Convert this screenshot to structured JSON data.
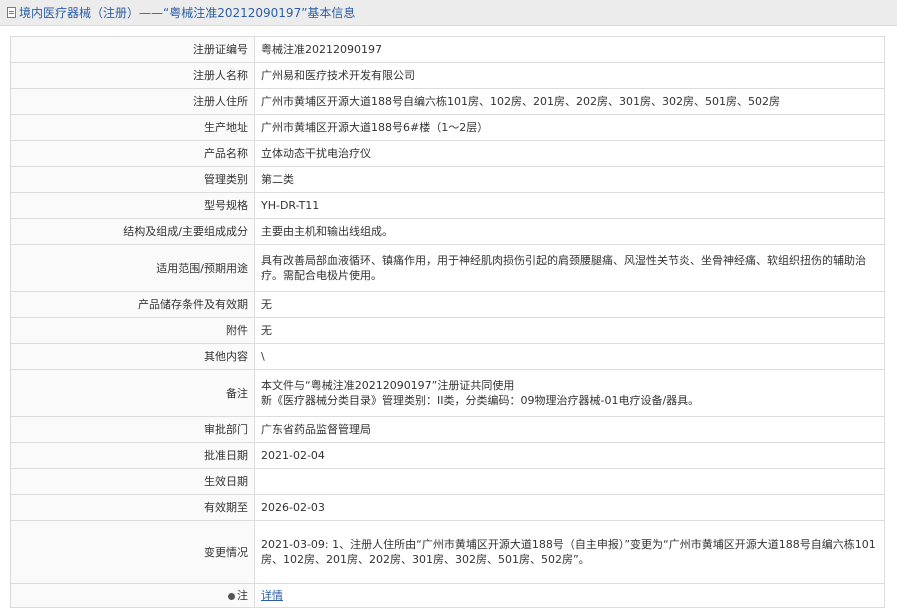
{
  "header": {
    "title": "境内医疗器械（注册）——“粤械注准20212090197”基本信息"
  },
  "rows": {
    "reg_no": {
      "label": "注册证编号",
      "value": "粤械注准20212090197"
    },
    "registrant_name": {
      "label": "注册人名称",
      "value": "广州易和医疗技术开发有限公司"
    },
    "registrant_address": {
      "label": "注册人住所",
      "value": "广州市黄埔区开源大道188号自编六栋101房、102房、201房、202房、301房、302房、501房、502房"
    },
    "production_address": {
      "label": "生产地址",
      "value": "广州市黄埔区开源大道188号6#楼（1～2层）"
    },
    "product_name": {
      "label": "产品名称",
      "value": "立体动态干扰电治疗仪"
    },
    "category": {
      "label": "管理类别",
      "value": "第二类"
    },
    "model": {
      "label": "型号规格",
      "value": "YH-DR-T11"
    },
    "structure": {
      "label": "结构及组成/主要组成成分",
      "value": "主要由主机和输出线组成。"
    },
    "scope": {
      "label": "适用范围/预期用途",
      "value": "具有改善局部血液循环、镇痛作用，用于神经肌肉损伤引起的肩颈腰腿痛、风湿性关节炎、坐骨神经痛、软组织扭伤的辅助治疗。需配合电极片使用。"
    },
    "storage": {
      "label": "产品储存条件及有效期",
      "value": "无"
    },
    "accessories": {
      "label": "附件",
      "value": "无"
    },
    "other": {
      "label": "其他内容",
      "value": "\\"
    },
    "remarks": {
      "label": "备注",
      "line1": "本文件与“粤械注准20212090197”注册证共同使用",
      "line2": "新《医疗器械分类目录》管理类别：II类，分类编码：09物理治疗器械-01电疗设备/器具。"
    },
    "dept": {
      "label": "审批部门",
      "value": "广东省药品监督管理局"
    },
    "approval_date": {
      "label": "批准日期",
      "value": "2021-02-04"
    },
    "effective_date": {
      "label": "生效日期",
      "value": ""
    },
    "valid_until": {
      "label": "有效期至",
      "value": "2026-02-03"
    },
    "changes": {
      "label": "变更情况",
      "value": "2021-03-09: 1、注册人住所由“广州市黄埔区开源大道188号（自主申报）”变更为“广州市黄埔区开源大道188号自编六栋101房、102房、201房、202房、301房、302房、501房、502房”。"
    },
    "note": {
      "label": "注",
      "link": "详情",
      "icon": "dot-icon"
    }
  }
}
